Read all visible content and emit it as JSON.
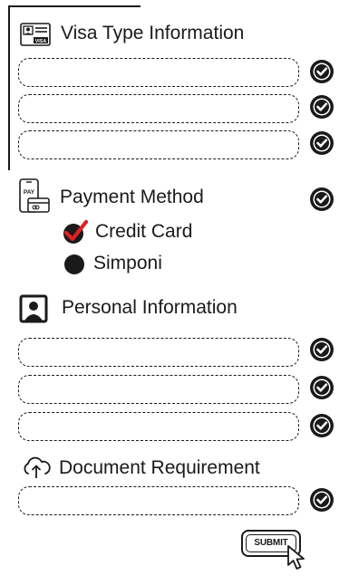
{
  "sections": {
    "visa": {
      "title": "Visa Type Information",
      "icon": "visa-card-icon"
    },
    "payment": {
      "title": "Payment Method",
      "icon": "pay-phone-icon",
      "options": [
        {
          "label": "Credit Card",
          "selected": true
        },
        {
          "label": "Simponi",
          "selected": false
        }
      ]
    },
    "personal": {
      "title": "Personal Information",
      "icon": "user-id-icon"
    },
    "document": {
      "title": "Document Requirement",
      "icon": "cloud-upload-icon"
    }
  },
  "submit": {
    "label": "SUBMIT",
    "icon": "cursor-icon"
  },
  "colors": {
    "ink": "#1a1a1a",
    "accent": "#e02020"
  }
}
